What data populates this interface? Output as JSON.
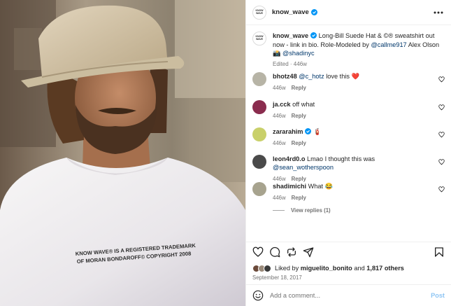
{
  "post": {
    "username": "know_wave",
    "avatar_logo_lines": [
      "KNOW",
      "WAVE",
      "®"
    ],
    "caption_text": "Long-Bill Suede Hat & ©® sweatshirt out now - link in bio. Role-Modeled by",
    "caption_mention_1": "@callme917",
    "caption_mid": "Alex Olson 📸",
    "caption_mention_2": "@shadinyc",
    "edited_label": "Edited",
    "age": "446w",
    "shirt_line_1": "KNOW WAVE® IS A REGISTERED TRADEMARK",
    "shirt_line_2": "OF MORAN BONDAROFF© COPYRIGHT 2008",
    "likes_prefix": "Liked by",
    "liked_by": "miguelito_bonito",
    "likes_and": "and",
    "likes_others": "1,817 others",
    "date": "September 18, 2017"
  },
  "comments": [
    {
      "username": "bhotz48",
      "mention": "@c_hotz",
      "text": "love this ❤️",
      "age": "446w",
      "reply": "Reply",
      "avatar_color": "#b7b4a6"
    },
    {
      "username": "ja.cck",
      "mention": "",
      "text": "off what",
      "age": "446w",
      "reply": "Reply",
      "avatar_color": "#8a2c4e"
    },
    {
      "username": "zararahim",
      "mention": "",
      "text": "🧯",
      "age": "446w",
      "reply": "Reply",
      "avatar_color": "#c9d06a",
      "verified": true
    },
    {
      "username": "leon4rd0.o",
      "mention": "@sean_wotherspoon",
      "text": "Lmao I thought this was",
      "age": "446w",
      "reply": "Reply",
      "avatar_color": "#4a4a4a"
    },
    {
      "username": "shadimichi",
      "mention": "",
      "text": "What 😂",
      "age": "446w",
      "reply": "Reply",
      "avatar_color": "#a7a38e"
    }
  ],
  "view_replies": "View replies (1)",
  "add_comment": {
    "placeholder": "Add a comment...",
    "post_label": "Post"
  },
  "colors": {
    "verified": "#0095f6",
    "link": "#00376b",
    "post_button": "#8ec5f4",
    "muted": "#737373"
  },
  "icons": [
    "more-icon",
    "heart-icon",
    "comment-icon",
    "share-icon",
    "send-icon",
    "bookmark-icon",
    "emoji-icon",
    "verified-badge-icon"
  ]
}
